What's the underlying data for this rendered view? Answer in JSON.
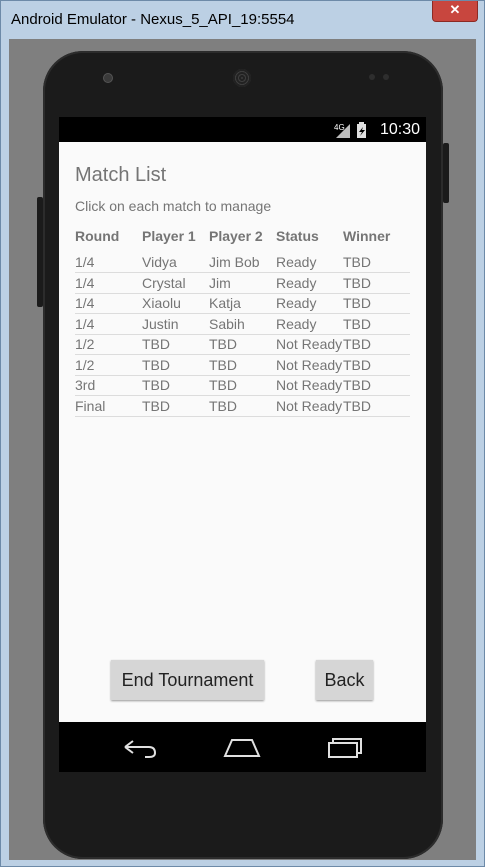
{
  "window": {
    "title": "Android Emulator - Nexus_5_API_19:5554",
    "close_label": "✕"
  },
  "statusbar": {
    "network": "4G",
    "time": "10:30"
  },
  "app": {
    "title": "Match List",
    "subtitle": "Click on each match to manage",
    "columns": [
      "Round",
      "Player 1",
      "Player 2",
      "Status",
      "Winner"
    ],
    "rows": [
      [
        "1/4",
        "Vidya",
        "Jim Bob",
        "Ready",
        "TBD"
      ],
      [
        "1/4",
        "Crystal",
        "Jim",
        "Ready",
        "TBD"
      ],
      [
        "1/4",
        "Xiaolu",
        "Katja",
        "Ready",
        "TBD"
      ],
      [
        "1/4",
        "Justin",
        "Sabih",
        "Ready",
        "TBD"
      ],
      [
        "1/2",
        "TBD",
        "TBD",
        "Not Ready",
        "TBD"
      ],
      [
        "1/2",
        "TBD",
        "TBD",
        "Not Ready",
        "TBD"
      ],
      [
        "3rd",
        "TBD",
        "TBD",
        "Not Ready",
        "TBD"
      ],
      [
        "Final",
        "TBD",
        "TBD",
        "Not Ready",
        "TBD"
      ]
    ],
    "end_button": "End Tournament",
    "back_button": "Back"
  },
  "navbar": {
    "icons": [
      "back-icon",
      "home-icon",
      "recent-apps-icon"
    ]
  }
}
